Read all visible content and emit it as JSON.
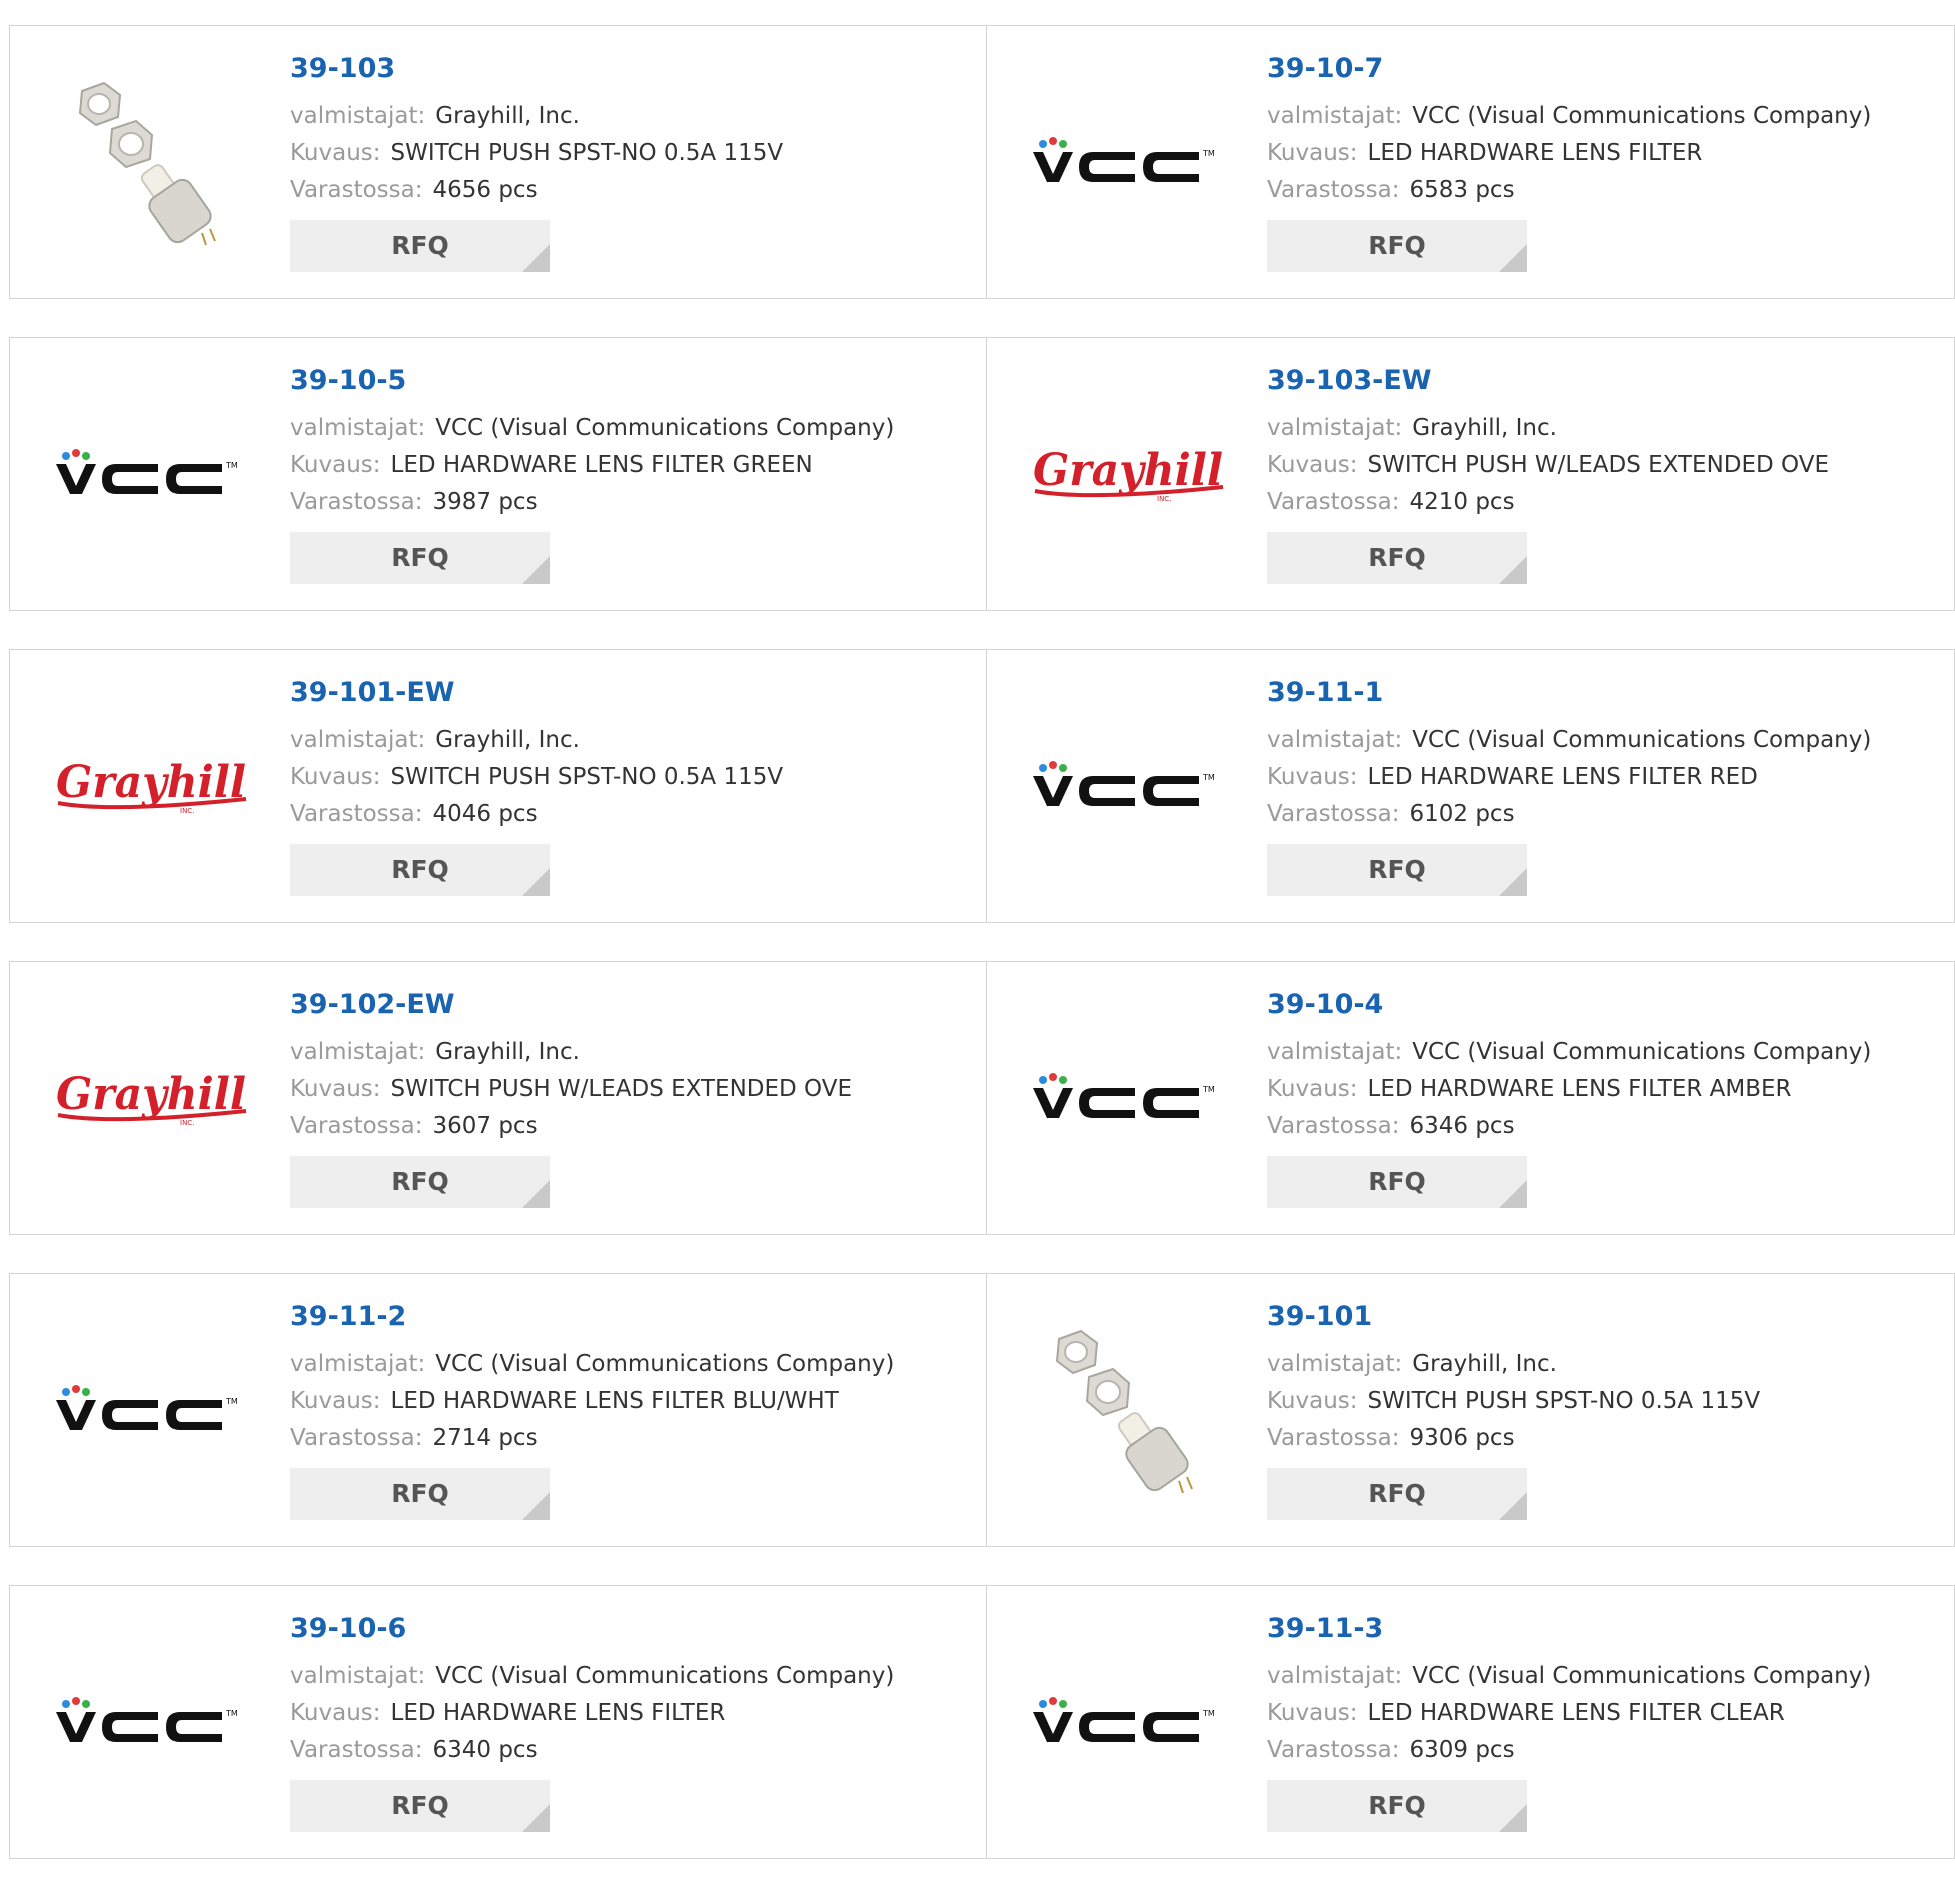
{
  "labels": {
    "manufacturer": "valmistajat:",
    "description": "Kuvaus:",
    "stock": "Varastossa:",
    "rfq": "RFQ"
  },
  "colors": {
    "part_link": "#1a63b0",
    "label": "#9a9a9a",
    "value": "#333333",
    "rfq_bg": "#eeeeee",
    "grayhill_red": "#d4202a",
    "vcc_black": "#111111"
  },
  "products": [
    {
      "part": "39-103",
      "manufacturer": "Grayhill, Inc.",
      "description": "SWITCH PUSH SPST-NO 0.5A 115V",
      "stock": "4656 pcs",
      "image": "switch-photo-icon"
    },
    {
      "part": "39-10-7",
      "manufacturer": "VCC (Visual Communications Company)",
      "description": "LED HARDWARE LENS FILTER",
      "stock": "6583 pcs",
      "image": "vcc-logo-icon"
    },
    {
      "part": "39-10-5",
      "manufacturer": "VCC (Visual Communications Company)",
      "description": "LED HARDWARE LENS FILTER GREEN",
      "stock": "3987 pcs",
      "image": "vcc-logo-icon"
    },
    {
      "part": "39-103-EW",
      "manufacturer": "Grayhill, Inc.",
      "description": "SWITCH PUSH W/LEADS EXTENDED OVE",
      "stock": "4210 pcs",
      "image": "grayhill-logo-icon"
    },
    {
      "part": "39-101-EW",
      "manufacturer": "Grayhill, Inc.",
      "description": "SWITCH PUSH SPST-NO 0.5A 115V",
      "stock": "4046 pcs",
      "image": "grayhill-logo-icon"
    },
    {
      "part": "39-11-1",
      "manufacturer": "VCC (Visual Communications Company)",
      "description": "LED HARDWARE LENS FILTER RED",
      "stock": "6102 pcs",
      "image": "vcc-logo-icon"
    },
    {
      "part": "39-102-EW",
      "manufacturer": "Grayhill, Inc.",
      "description": "SWITCH PUSH W/LEADS EXTENDED OVE",
      "stock": "3607 pcs",
      "image": "grayhill-logo-icon"
    },
    {
      "part": "39-10-4",
      "manufacturer": "VCC (Visual Communications Company)",
      "description": "LED HARDWARE LENS FILTER AMBER",
      "stock": "6346 pcs",
      "image": "vcc-logo-icon"
    },
    {
      "part": "39-11-2",
      "manufacturer": "VCC (Visual Communications Company)",
      "description": "LED HARDWARE LENS FILTER BLU/WHT",
      "stock": "2714 pcs",
      "image": "vcc-logo-icon"
    },
    {
      "part": "39-101",
      "manufacturer": "Grayhill, Inc.",
      "description": "SWITCH PUSH SPST-NO 0.5A 115V",
      "stock": "9306 pcs",
      "image": "switch-photo-icon"
    },
    {
      "part": "39-10-6",
      "manufacturer": "VCC (Visual Communications Company)",
      "description": "LED HARDWARE LENS FILTER",
      "stock": "6340 pcs",
      "image": "vcc-logo-icon"
    },
    {
      "part": "39-11-3",
      "manufacturer": "VCC (Visual Communications Company)",
      "description": "LED HARDWARE LENS FILTER CLEAR",
      "stock": "6309 pcs",
      "image": "vcc-logo-icon"
    }
  ]
}
